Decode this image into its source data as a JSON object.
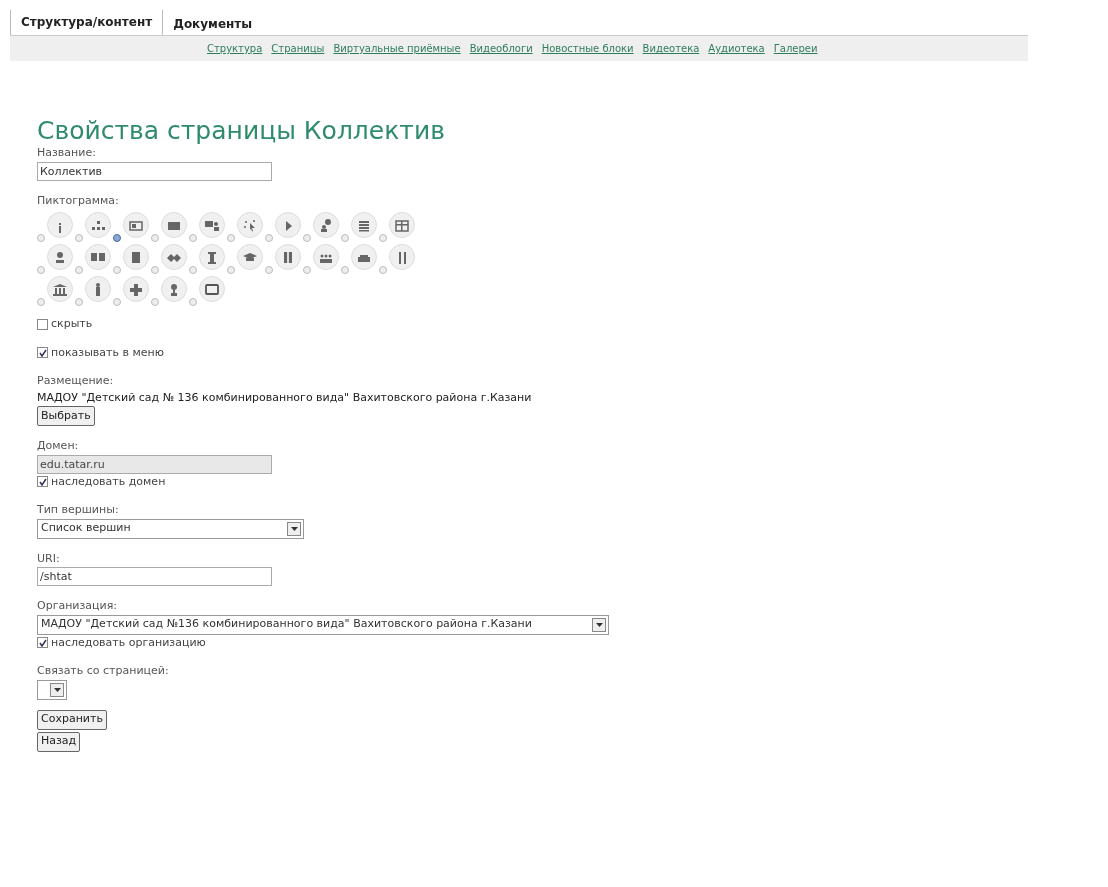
{
  "tabs": [
    {
      "label": "Структура/контент",
      "selected": true
    },
    {
      "label": "Документы",
      "selected": false
    }
  ],
  "subnav": [
    "Структура",
    "Страницы",
    "Виртуальные приёмные",
    "Видеоблоги",
    "Новостные блоки",
    "Видеотека",
    "Аудиотека",
    "Галереи"
  ],
  "title": "Свойства страницы Коллектив",
  "name_field": {
    "label": "Название:",
    "value": "Коллектив"
  },
  "pictogram": {
    "label": "Пиктограмма:",
    "options": [
      {
        "selected": false
      },
      {
        "selected": false
      },
      {
        "selected": true
      },
      {
        "selected": false
      },
      {
        "selected": false
      },
      {
        "selected": false
      },
      {
        "selected": false
      },
      {
        "selected": false
      },
      {
        "selected": false
      },
      {
        "selected": false
      },
      {
        "selected": false
      },
      {
        "selected": false
      },
      {
        "selected": false
      },
      {
        "selected": false
      },
      {
        "selected": false
      },
      {
        "selected": false
      },
      {
        "selected": false
      },
      {
        "selected": false
      },
      {
        "selected": false
      },
      {
        "selected": false
      },
      {
        "selected": false
      },
      {
        "selected": false
      },
      {
        "selected": false
      },
      {
        "selected": false
      },
      {
        "selected": false
      }
    ]
  },
  "hide": {
    "label": "скрыть",
    "checked": false
  },
  "show_in_menu": {
    "label": "показывать в меню",
    "checked": true
  },
  "placement": {
    "label": "Размещение:",
    "value": "МАДОУ \"Детский сад № 136 комбинированного вида\" Вахитовского района г.Казани",
    "button": "Выбрать"
  },
  "domain": {
    "label": "Домен:",
    "value": "edu.tatar.ru",
    "disabled": true,
    "inherit": {
      "label": "наследовать домен",
      "checked": true
    }
  },
  "node_type": {
    "label": "Тип вершины:",
    "value": "Список вершин"
  },
  "uri": {
    "label": "URI:",
    "value": "/shtat"
  },
  "organization": {
    "label": "Организация:",
    "value": "МАДОУ \"Детский сад №136 комбинированного вида\" Вахитовского района г.Казани",
    "inherit": {
      "label": "наследовать организацию",
      "checked": true
    }
  },
  "link_page": {
    "label": "Связать со страницей:"
  },
  "buttons": [
    "Сохранить",
    "Назад"
  ]
}
